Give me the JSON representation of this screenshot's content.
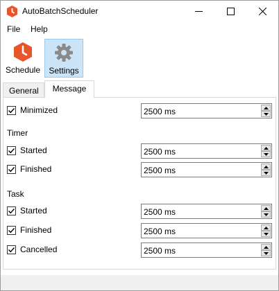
{
  "window": {
    "title": "AutoBatchScheduler",
    "icon": "app-logo-icon"
  },
  "menu": {
    "items": [
      {
        "label": "File"
      },
      {
        "label": "Help"
      }
    ]
  },
  "toolbar": {
    "schedule_label": "Schedule",
    "settings_label": "Settings",
    "schedule_icon": "clock-icon",
    "settings_icon": "gear-icon",
    "active": "Settings"
  },
  "tabs": {
    "general_label": "General",
    "message_label": "Message",
    "selected": "Message"
  },
  "message": {
    "minimized": {
      "label": "Minimized",
      "checked": true,
      "value": "2500 ms"
    },
    "timer": {
      "title": "Timer",
      "started": {
        "label": "Started",
        "checked": true,
        "value": "2500 ms"
      },
      "finished": {
        "label": "Finished",
        "checked": true,
        "value": "2500 ms"
      }
    },
    "task": {
      "title": "Task",
      "started": {
        "label": "Started",
        "checked": true,
        "value": "2500 ms"
      },
      "finished": {
        "label": "Finished",
        "checked": true,
        "value": "2500 ms"
      },
      "cancelled": {
        "label": "Cancelled",
        "checked": true,
        "value": "2500 ms"
      }
    }
  },
  "colors": {
    "accent": "#cce4f7",
    "logo": "#e8552a"
  }
}
